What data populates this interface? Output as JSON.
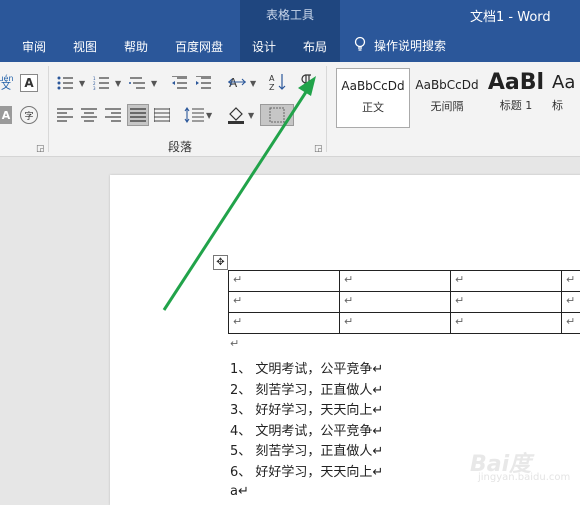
{
  "window": {
    "doc_title": "文档1  -  Word",
    "context_group": "表格工具"
  },
  "tabs": [
    "审阅",
    "视图",
    "帮助",
    "百度网盘",
    "设计",
    "布局"
  ],
  "tell_me": "操作说明搜索",
  "ribbon": {
    "paragraph_group_label": "段落",
    "partial_labels": [
      "uén",
      "文",
      "A",
      "A",
      "字"
    ],
    "styles": [
      {
        "sample": "AaBbCcDd",
        "name": "正文",
        "selected": true
      },
      {
        "sample": "AaBbCcDd",
        "name": "无间隔",
        "selected": false
      },
      {
        "sample": "AaBl",
        "name": "标题 1",
        "selected": false
      },
      {
        "sample": "Aa",
        "name": "标",
        "selected": false
      }
    ]
  },
  "document": {
    "table_rows": [
      [
        "↵",
        "↵",
        "↵",
        "↵"
      ],
      [
        "↵",
        "↵",
        "↵",
        "↵"
      ],
      [
        "↵",
        "↵",
        "↵",
        "↵"
      ]
    ],
    "after_table_mark": "↵",
    "list": [
      "1、 文明考试，公平竞争↵",
      "2、 刻苦学习，正直做人↵",
      "3、 好好学习，天天向上↵",
      "4、 文明考试，公平竞争↵",
      "5、 刻苦学习，正直做人↵",
      "6、 好好学习，天天向上↵"
    ],
    "last_line": "a↵"
  },
  "watermark": {
    "brand": "Bai度",
    "sub": "jingyan.baidu.com"
  },
  "colors": {
    "title_bar": "#2b579a",
    "context_band": "#1f467f",
    "arrow": "#21a34a"
  }
}
